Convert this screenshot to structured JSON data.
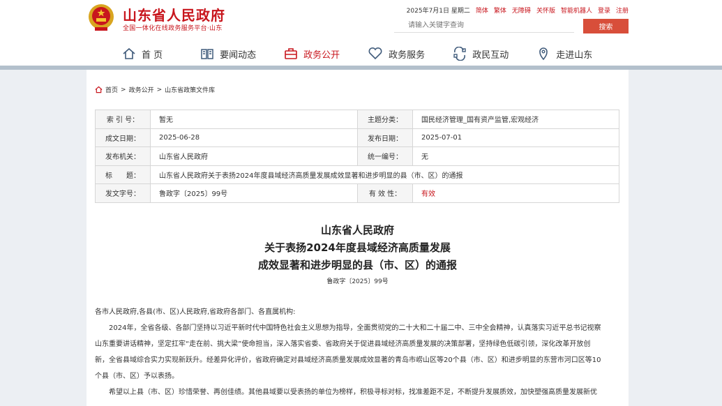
{
  "header": {
    "site_title": "山东省人民政府",
    "site_subtitle": "全国一体化在线政务服务平台·山东",
    "date": "2025年7月1日 星期二",
    "links": [
      "简体",
      "繁体",
      "无障碍",
      "关怀版",
      "智能机器人",
      "登录",
      "注册"
    ],
    "search_placeholder": "请输入关键字查询",
    "search_button": "搜索"
  },
  "nav": [
    {
      "label": "首 页",
      "icon": "home-icon"
    },
    {
      "label": "要闻动态",
      "icon": "news-icon"
    },
    {
      "label": "政务公开",
      "icon": "briefcase-icon",
      "active": true
    },
    {
      "label": "政务服务",
      "icon": "heart-icon"
    },
    {
      "label": "政民互动",
      "icon": "interaction-icon"
    },
    {
      "label": "走进山东",
      "icon": "location-icon"
    }
  ],
  "breadcrumb": [
    "首页",
    "政务公开",
    "山东省政策文件库"
  ],
  "info": {
    "index_label": "索 引 号：",
    "index_value": "暂无",
    "topic_label": "主题分类：",
    "topic_value": "国民经济管理_国有资产监管,宏观经济",
    "date_label": "成文日期：",
    "date_value": "2025-06-28",
    "publish_label": "发布日期：",
    "publish_value": "2025-07-01",
    "org_label": "发布机关：",
    "org_value": "山东省人民政府",
    "serial_label": "统一编号：",
    "serial_value": "无",
    "title_label": "标　　题：",
    "title_value": "山东省人民政府关于表扬2024年度县域经济高质量发展成效显著和进步明显的县（市、区）的通报",
    "docno_label": "发文字号：",
    "docno_value": "鲁政字〔2025〕99号",
    "validity_label": "有 效 性：",
    "validity_value": "有效"
  },
  "document": {
    "title_line1": "山东省人民政府",
    "title_line2": "关于表扬2024年度县域经济高质量发展",
    "title_line3": "成效显著和进步明显的县（市、区）的通报",
    "doc_no": "鲁政字〔2025〕99号",
    "salutation": "各市人民政府,各县(市、区)人民政府,省政府各部门、各直属机构:",
    "p1_l1": "2024年，全省各级、各部门坚持以习近平新时代中国特色社会主义思想为指导，全面贯彻党的二十大和二十届二中、三中全会精神，认真落实习近平总书记视察",
    "p1_l2": "山东重要讲话精神，坚定扛牢“走在前、挑大梁”使命担当，深入落实省委、省政府关于促进县域经济高质量发展的决策部署，坚持绿色低碳引领，深化改革开放创",
    "p1_l3": "新，全省县域综合实力实现新跃升。经差异化评价，省政府确定对县域经济高质量发展成效显著的青岛市崂山区等20个县（市、区）和进步明显的东营市河口区等10",
    "p1_l4": "个县（市、区）予以表扬。",
    "p2_l1": "希望以上县（市、区）珍惜荣誉、再创佳绩。其他县域要以受表扬的单位为榜样，积极寻标对标，找准差距不足，不断提升发展质效，加快塑强高质量发展新优"
  }
}
